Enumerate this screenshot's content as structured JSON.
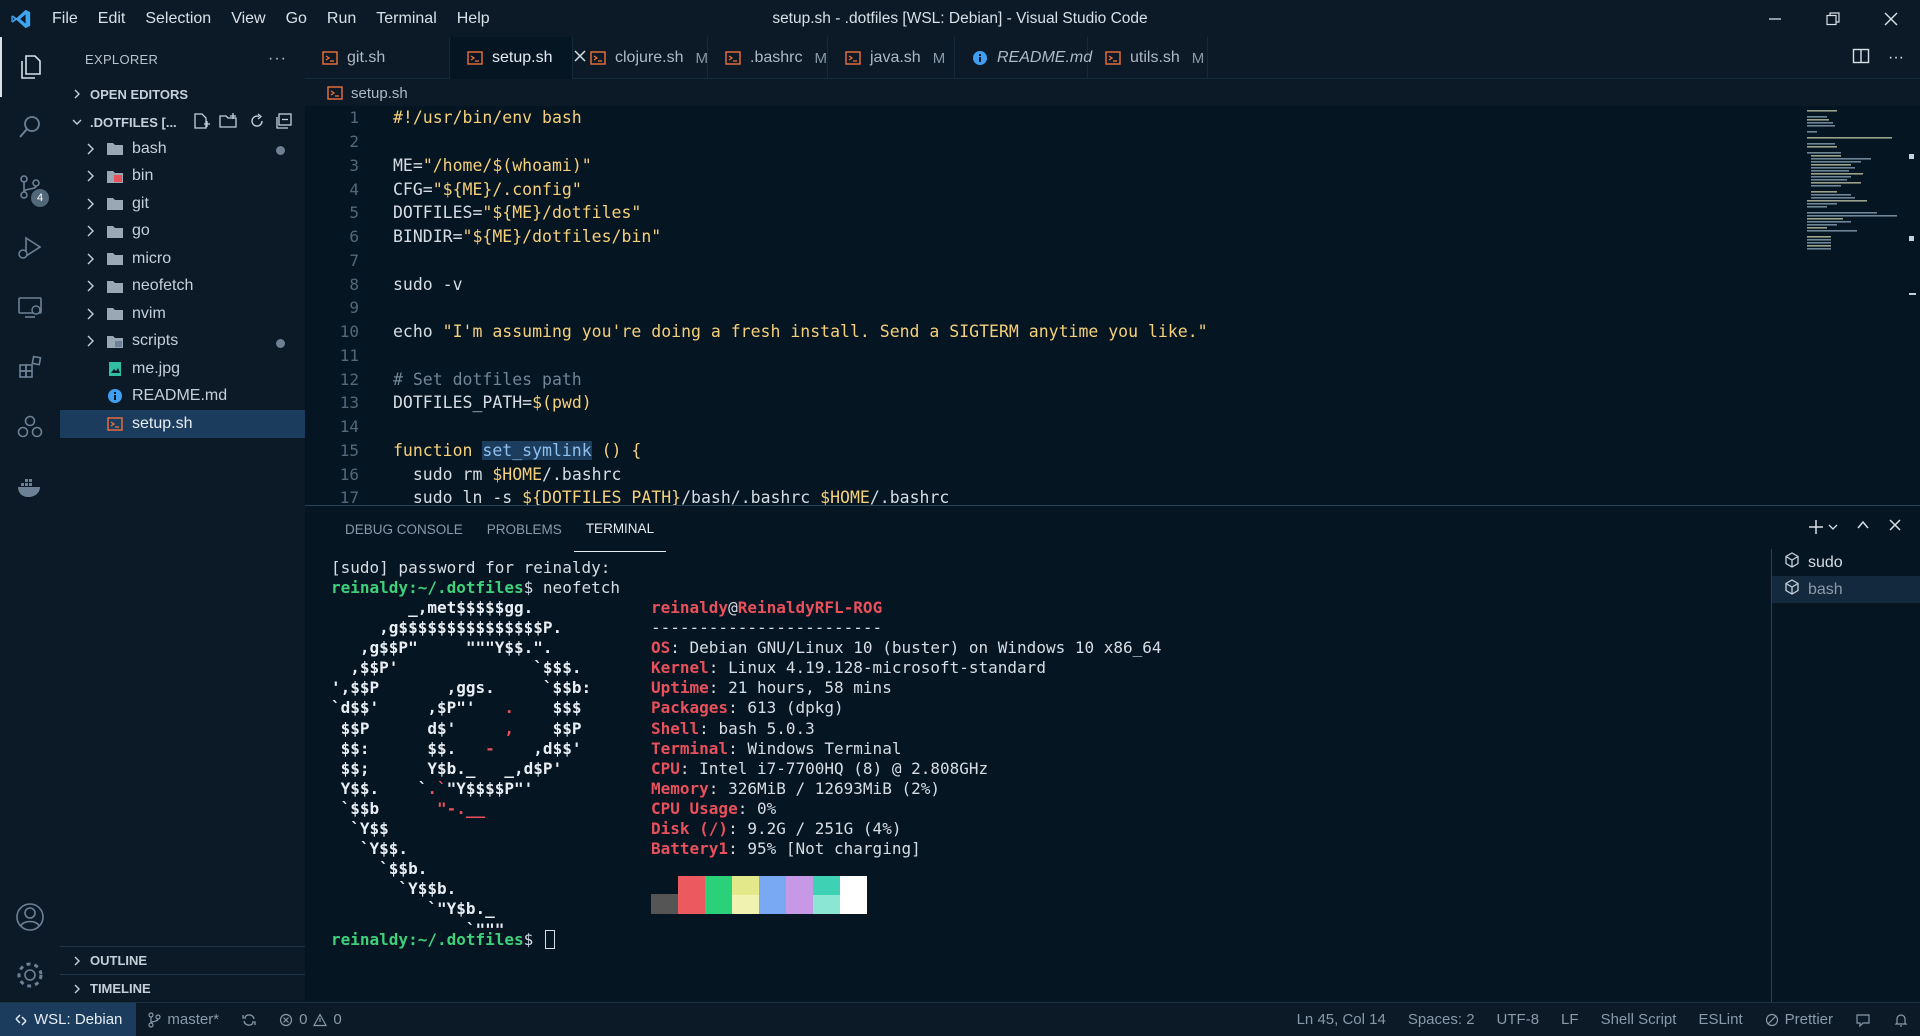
{
  "window": {
    "title": "setup.sh - .dotfiles [WSL: Debian] - Visual Studio Code",
    "menus": [
      "File",
      "Edit",
      "Selection",
      "View",
      "Go",
      "Run",
      "Terminal",
      "Help"
    ]
  },
  "activity_bar": {
    "source_control_badge": "4"
  },
  "sidebar": {
    "header": "EXPLORER",
    "open_editors": "OPEN EDITORS",
    "project": ".DOTFILES [...",
    "items": [
      {
        "label": "bash",
        "type": "folder",
        "modified": true
      },
      {
        "label": "bin",
        "type": "folder-red",
        "modified": false
      },
      {
        "label": "git",
        "type": "folder",
        "modified": false
      },
      {
        "label": "go",
        "type": "folder",
        "modified": false
      },
      {
        "label": "micro",
        "type": "folder",
        "modified": false
      },
      {
        "label": "neofetch",
        "type": "folder",
        "modified": false
      },
      {
        "label": "nvim",
        "type": "folder",
        "modified": false
      },
      {
        "label": "scripts",
        "type": "folder-scripts",
        "modified": true
      },
      {
        "label": "me.jpg",
        "type": "image",
        "modified": false
      },
      {
        "label": "README.md",
        "type": "info",
        "modified": false
      },
      {
        "label": "setup.sh",
        "type": "shell",
        "modified": false
      }
    ],
    "outline": "OUTLINE",
    "timeline": "TIMELINE"
  },
  "tabs": [
    {
      "label": "git.sh",
      "mod": "",
      "active": false,
      "italic": false
    },
    {
      "label": "setup.sh",
      "mod": "",
      "active": true,
      "italic": false
    },
    {
      "label": "clojure.sh",
      "mod": "M",
      "active": false,
      "italic": false
    },
    {
      "label": ".bashrc",
      "mod": "M",
      "active": false,
      "italic": false
    },
    {
      "label": "java.sh",
      "mod": "M",
      "active": false,
      "italic": false
    },
    {
      "label": "README.md",
      "mod": "",
      "active": false,
      "italic": true
    },
    {
      "label": "utils.sh",
      "mod": "M",
      "active": false,
      "italic": false
    }
  ],
  "breadcrumb": "setup.sh",
  "editor": {
    "lines": [
      {
        "n": "1",
        "parts": [
          [
            "kw",
            "#!/usr/bin/env bash"
          ]
        ]
      },
      {
        "n": "2",
        "parts": []
      },
      {
        "n": "3",
        "parts": [
          [
            "",
            "ME="
          ],
          [
            "str",
            "\"/home/$(whoami)\""
          ]
        ]
      },
      {
        "n": "4",
        "parts": [
          [
            "",
            "CFG="
          ],
          [
            "str",
            "\"${ME}/.config\""
          ]
        ]
      },
      {
        "n": "5",
        "parts": [
          [
            "",
            "DOTFILES="
          ],
          [
            "str",
            "\"${ME}/dotfiles\""
          ]
        ]
      },
      {
        "n": "6",
        "parts": [
          [
            "",
            "BINDIR="
          ],
          [
            "str",
            "\"${ME}/dotfiles/bin\""
          ]
        ]
      },
      {
        "n": "7",
        "parts": []
      },
      {
        "n": "8",
        "parts": [
          [
            "",
            "sudo -v"
          ]
        ]
      },
      {
        "n": "9",
        "parts": []
      },
      {
        "n": "10",
        "parts": [
          [
            "",
            "echo "
          ],
          [
            "str",
            "\"I'm assuming you're doing a fresh install. Send a SIGTERM anytime you like.\""
          ]
        ]
      },
      {
        "n": "11",
        "parts": []
      },
      {
        "n": "12",
        "parts": [
          [
            "com",
            "# Set dotfiles path"
          ]
        ]
      },
      {
        "n": "13",
        "parts": [
          [
            "",
            "DOTFILES_PATH="
          ],
          [
            "str",
            "$(pwd)"
          ]
        ]
      },
      {
        "n": "14",
        "parts": []
      },
      {
        "n": "15",
        "parts": [
          [
            "kw",
            "function "
          ],
          [
            "fn",
            "set_symlink"
          ],
          [
            "kw",
            " () {"
          ]
        ]
      },
      {
        "n": "16",
        "parts": [
          [
            "",
            "  sudo rm "
          ],
          [
            "var",
            "$HOME"
          ],
          [
            "",
            "/.bashrc"
          ]
        ]
      },
      {
        "n": "17",
        "parts": [
          [
            "",
            "  sudo ln -s "
          ],
          [
            "var",
            "${DOTFILES_PATH}"
          ],
          [
            "",
            "/bash/.bashrc "
          ],
          [
            "var",
            "$HOME"
          ],
          [
            "",
            "/.bashrc"
          ]
        ]
      }
    ]
  },
  "panel": {
    "tabs": [
      "DEBUG CONSOLE",
      "PROBLEMS",
      "TERMINAL"
    ],
    "active_tab": "TERMINAL",
    "terminals": [
      "sudo",
      "bash"
    ]
  },
  "terminal": {
    "sudo_line": "[sudo] password for reinaldy:",
    "prompt": "reinaldy:~/.dotfiles",
    "command": "neofetch",
    "ascii": [
      "        _,met$$$$$gg.",
      "     ,g$$$$$$$$$$$$$$$P.",
      "   ,g$$P\"     \"\"\"Y$$.\".",
      "  ,$$P'              `$$$.",
      "',$$P       ,ggs.     `$$b:",
      "`d$$'     ,$P\"'   .    $$$",
      " $$P      d$'     ,    $$P",
      " $$:      $$.   -    ,d$$'",
      " $$;      Y$b._   _,d$P'",
      " Y$$.    `.`\"Y$$$$P\"'",
      " `$$b      \"-.__",
      "  `Y$$",
      "   `Y$$.",
      "     `$$b.",
      "       `Y$$b.",
      "          `\"Y$b._",
      "              `\"\"\""
    ],
    "user_host": [
      "reinaldy",
      "@",
      "ReinaldyRFL-ROG"
    ],
    "separator": "------------------------",
    "info": [
      [
        "OS",
        "Debian GNU/Linux 10 (buster) on Windows 10 x86_64"
      ],
      [
        "Kernel",
        "Linux 4.19.128-microsoft-standard"
      ],
      [
        "Uptime",
        "21 hours, 58 mins"
      ],
      [
        "Packages",
        "613 (dpkg)"
      ],
      [
        "Shell",
        "bash 5.0.3"
      ],
      [
        "Terminal",
        "Windows Terminal"
      ],
      [
        "CPU",
        "Intel i7-7700HQ (8) @ 2.808GHz"
      ],
      [
        "Memory",
        "326MiB / 12693MiB (2%)"
      ],
      [
        "CPU Usage",
        "0%"
      ],
      [
        "Disk (/)",
        "9.2G / 251G (4%)"
      ],
      [
        "Battery1",
        "95% [Not charging]"
      ]
    ],
    "swatches": [
      "#555555",
      "#ec5a5f",
      "#2bd179",
      "#e3e88a",
      "#78a9f2",
      "#c798e6",
      "#3fd1b3",
      "#ffffff"
    ]
  },
  "statusbar": {
    "remote": "WSL: Debian",
    "branch": "master*",
    "errors": "0",
    "warnings": "0",
    "position": "Ln 45, Col 14",
    "spaces": "Spaces: 2",
    "encoding": "UTF-8",
    "eol": "LF",
    "language": "Shell Script",
    "eslint": "ESLint",
    "prettier": "Prettier"
  }
}
